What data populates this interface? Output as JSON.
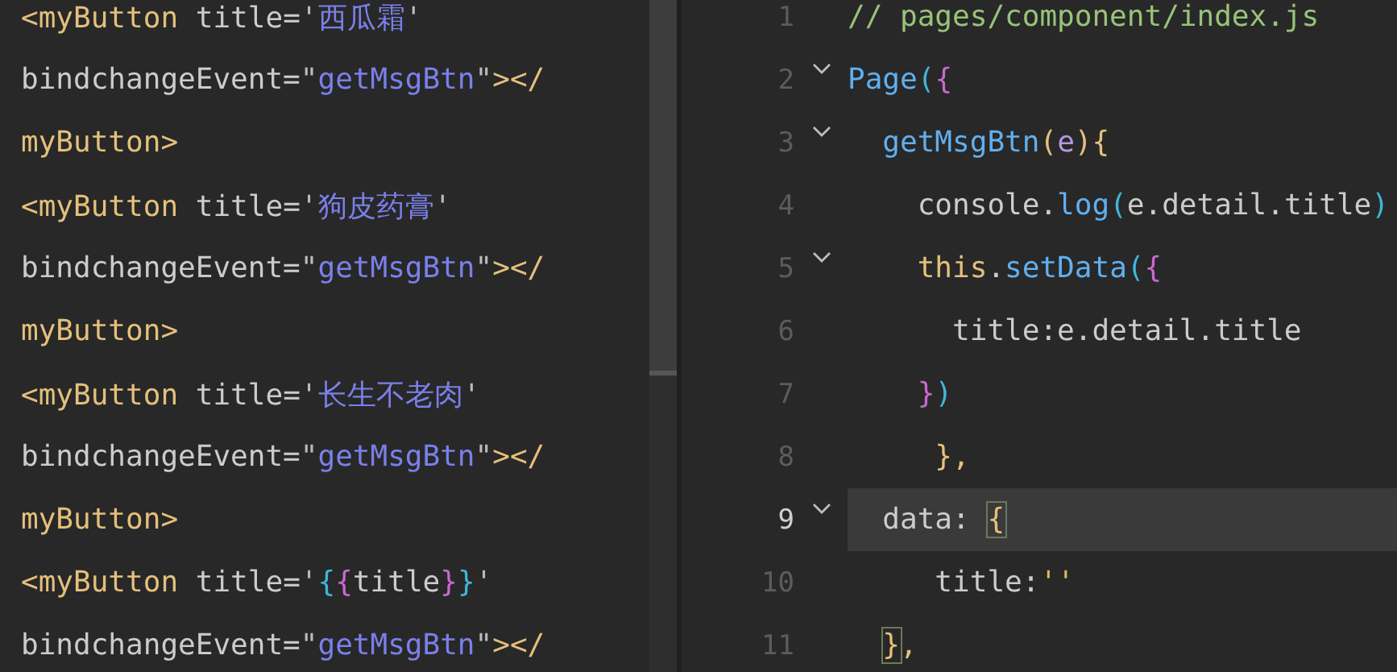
{
  "left_pane": {
    "lines": [
      {
        "tokens": [
          {
            "kind": "tag",
            "text": "<myButton"
          },
          {
            "kind": "plain",
            "text": " title="
          },
          {
            "kind": "punct",
            "text": "'"
          },
          {
            "kind": "string",
            "text": "西瓜霜"
          },
          {
            "kind": "punct",
            "text": "'"
          }
        ]
      },
      {
        "tokens": [
          {
            "kind": "plain",
            "text": "bindchangeEvent="
          },
          {
            "kind": "punct",
            "text": "\""
          },
          {
            "kind": "string",
            "text": "getMsgBtn"
          },
          {
            "kind": "punct",
            "text": "\""
          },
          {
            "kind": "tag",
            "text": "></"
          }
        ]
      },
      {
        "tokens": [
          {
            "kind": "tag",
            "text": "myButton>"
          }
        ]
      },
      {
        "tokens": [
          {
            "kind": "tag",
            "text": "<myButton"
          },
          {
            "kind": "plain",
            "text": " title="
          },
          {
            "kind": "punct",
            "text": "'"
          },
          {
            "kind": "string",
            "text": "狗皮药膏"
          },
          {
            "kind": "punct",
            "text": "'"
          }
        ]
      },
      {
        "tokens": [
          {
            "kind": "plain",
            "text": "bindchangeEvent="
          },
          {
            "kind": "punct",
            "text": "\""
          },
          {
            "kind": "string",
            "text": "getMsgBtn"
          },
          {
            "kind": "punct",
            "text": "\""
          },
          {
            "kind": "tag",
            "text": "></"
          }
        ]
      },
      {
        "tokens": [
          {
            "kind": "tag",
            "text": "myButton>"
          }
        ]
      },
      {
        "tokens": [
          {
            "kind": "tag",
            "text": "<myButton"
          },
          {
            "kind": "plain",
            "text": " title="
          },
          {
            "kind": "punct",
            "text": "'"
          },
          {
            "kind": "string",
            "text": "长生不老肉"
          },
          {
            "kind": "punct",
            "text": "'"
          }
        ]
      },
      {
        "tokens": [
          {
            "kind": "plain",
            "text": "bindchangeEvent="
          },
          {
            "kind": "punct",
            "text": "\""
          },
          {
            "kind": "string",
            "text": "getMsgBtn"
          },
          {
            "kind": "punct",
            "text": "\""
          },
          {
            "kind": "tag",
            "text": "></"
          }
        ]
      },
      {
        "tokens": [
          {
            "kind": "tag",
            "text": "myButton>"
          }
        ]
      },
      {
        "tokens": [
          {
            "kind": "tag",
            "text": "<myButton"
          },
          {
            "kind": "plain",
            "text": " title="
          },
          {
            "kind": "punct",
            "text": "'"
          },
          {
            "kind": "paren",
            "text": "{"
          },
          {
            "kind": "brace",
            "text": "{"
          },
          {
            "kind": "plain",
            "text": "title"
          },
          {
            "kind": "brace",
            "text": "}"
          },
          {
            "kind": "paren",
            "text": "}"
          },
          {
            "kind": "punct",
            "text": "'"
          }
        ]
      },
      {
        "tokens": [
          {
            "kind": "plain",
            "text": "bindchangeEvent="
          },
          {
            "kind": "punct",
            "text": "\""
          },
          {
            "kind": "string",
            "text": "getMsgBtn"
          },
          {
            "kind": "punct",
            "text": "\""
          },
          {
            "kind": "tag",
            "text": "></"
          }
        ]
      }
    ]
  },
  "right_pane": {
    "lines": [
      {
        "number": "1",
        "current": false,
        "foldable": false,
        "tokens": [
          {
            "kind": "comment",
            "text": "// pages/component/index.js"
          }
        ]
      },
      {
        "number": "2",
        "current": false,
        "foldable": true,
        "tokens": [
          {
            "kind": "fn",
            "text": "Page"
          },
          {
            "kind": "paren",
            "text": "("
          },
          {
            "kind": "brace",
            "text": "{"
          }
        ]
      },
      {
        "number": "3",
        "current": false,
        "foldable": true,
        "tokens": [
          {
            "kind": "fn",
            "text": "  getMsgBtn"
          },
          {
            "kind": "tag",
            "text": "("
          },
          {
            "kind": "param",
            "text": "e"
          },
          {
            "kind": "tag",
            "text": "){"
          }
        ]
      },
      {
        "number": "4",
        "current": false,
        "foldable": false,
        "tokens": [
          {
            "kind": "plain",
            "text": "    console."
          },
          {
            "kind": "fn",
            "text": "log"
          },
          {
            "kind": "paren",
            "text": "("
          },
          {
            "kind": "plain",
            "text": "e.detail.title"
          },
          {
            "kind": "paren",
            "text": ")"
          }
        ]
      },
      {
        "number": "5",
        "current": false,
        "foldable": true,
        "tokens": [
          {
            "kind": "tag",
            "text": "    this"
          },
          {
            "kind": "plain",
            "text": "."
          },
          {
            "kind": "fn",
            "text": "setData"
          },
          {
            "kind": "paren",
            "text": "("
          },
          {
            "kind": "brace",
            "text": "{"
          }
        ]
      },
      {
        "number": "6",
        "current": false,
        "foldable": false,
        "tokens": [
          {
            "kind": "plain",
            "text": "      title:e.detail.title"
          }
        ]
      },
      {
        "number": "7",
        "current": false,
        "foldable": false,
        "tokens": [
          {
            "kind": "brace",
            "text": "    }"
          },
          {
            "kind": "paren",
            "text": ")"
          }
        ]
      },
      {
        "number": "8",
        "current": false,
        "foldable": false,
        "tokens": [
          {
            "kind": "tag",
            "text": "     },"
          }
        ]
      },
      {
        "number": "9",
        "current": true,
        "foldable": true,
        "tokens": [
          {
            "kind": "plain",
            "text": "  data: "
          },
          {
            "kind": "match",
            "text": "{"
          }
        ]
      },
      {
        "number": "10",
        "current": false,
        "foldable": false,
        "tokens": [
          {
            "kind": "plain",
            "text": "     title:"
          },
          {
            "kind": "value",
            "text": "''"
          }
        ]
      },
      {
        "number": "11",
        "current": false,
        "foldable": false,
        "tokens": [
          {
            "kind": "match",
            "text": "}",
            "indented": true
          },
          {
            "kind": "tag",
            "text": ","
          }
        ]
      }
    ]
  }
}
